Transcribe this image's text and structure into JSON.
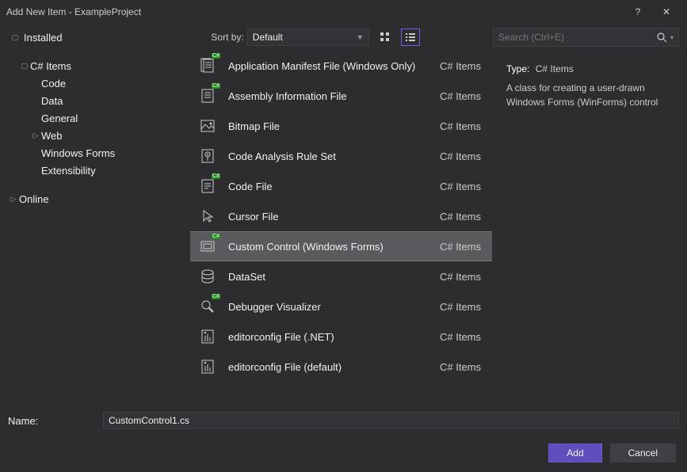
{
  "window": {
    "title": "Add New Item - ExampleProject",
    "help_tooltip": "?",
    "close_tooltip": "✕"
  },
  "toolbar": {
    "installed_label": "Installed",
    "sort_by_label": "Sort by:",
    "sort_by_value": "Default",
    "search_placeholder": "Search (Ctrl+E)"
  },
  "tree": {
    "items": [
      {
        "label": "C# Items",
        "expandable": true,
        "expanded": true,
        "indent": 1
      },
      {
        "label": "Code",
        "expandable": false,
        "indent": 2
      },
      {
        "label": "Data",
        "expandable": false,
        "indent": 2
      },
      {
        "label": "General",
        "expandable": false,
        "indent": 2
      },
      {
        "label": "Web",
        "expandable": true,
        "expanded": false,
        "indent": 2
      },
      {
        "label": "Windows Forms",
        "expandable": false,
        "indent": 2
      },
      {
        "label": "Extensibility",
        "expandable": false,
        "indent": 2
      }
    ],
    "online_label": "Online"
  },
  "templates": [
    {
      "label": "Application Manifest File (Windows Only)",
      "cat": "C# Items",
      "icon": "manifest",
      "csbadge": true
    },
    {
      "label": "Assembly Information File",
      "cat": "C# Items",
      "icon": "assembly",
      "csbadge": true
    },
    {
      "label": "Bitmap File",
      "cat": "C# Items",
      "icon": "bitmap"
    },
    {
      "label": "Code Analysis Rule Set",
      "cat": "C# Items",
      "icon": "ruleset"
    },
    {
      "label": "Code File",
      "cat": "C# Items",
      "icon": "codefile",
      "csbadge": true
    },
    {
      "label": "Cursor File",
      "cat": "C# Items",
      "icon": "cursor"
    },
    {
      "label": "Custom Control (Windows Forms)",
      "cat": "C# Items",
      "icon": "customcontrol",
      "csbadge": true,
      "selected": true
    },
    {
      "label": "DataSet",
      "cat": "C# Items",
      "icon": "dataset"
    },
    {
      "label": "Debugger Visualizer",
      "cat": "C# Items",
      "icon": "debugvis",
      "csbadge": true
    },
    {
      "label": "editorconfig File (.NET)",
      "cat": "C# Items",
      "icon": "editorconfig"
    },
    {
      "label": "editorconfig File (default)",
      "cat": "C# Items",
      "icon": "editorconfig"
    }
  ],
  "description": {
    "type_label": "Type:",
    "type_value": "C# Items",
    "text": "A class for creating a user-drawn Windows Forms (WinForms) control"
  },
  "name_field": {
    "label": "Name:",
    "value": "CustomControl1.cs"
  },
  "buttons": {
    "add": "Add",
    "cancel": "Cancel"
  }
}
